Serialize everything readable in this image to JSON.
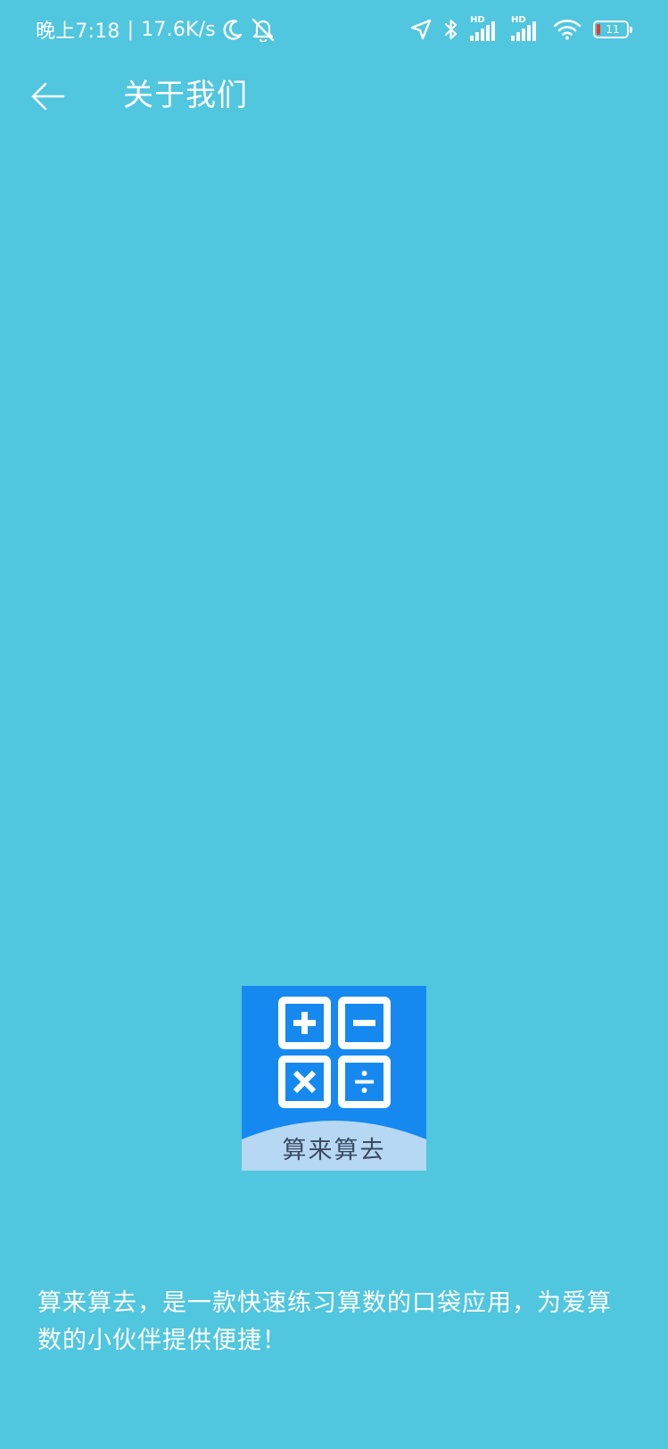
{
  "status_bar": {
    "time": "晚上7:18",
    "separator": "|",
    "net_speed": "17.6K/s",
    "sim1_label": "HD",
    "sim2_label": "HD",
    "battery_level": "11",
    "battery_color": "#e53935",
    "icons": [
      "moon-icon",
      "bell-off-icon",
      "location-arrow-icon",
      "bluetooth-icon",
      "signal-icon",
      "wifi-icon",
      "battery-icon"
    ]
  },
  "header": {
    "back_icon": "arrow-left-icon",
    "title": "关于我们"
  },
  "logo": {
    "label": "算来算去",
    "background_color": "#1589f0",
    "symbols": [
      "plus",
      "minus",
      "times",
      "divide"
    ]
  },
  "description": {
    "text": "算来算去，是一款快速练习算数的口袋应用，为爱算数的小伙伴提供便捷！"
  },
  "theme": {
    "background": "#50c6df",
    "text": "#ffffff"
  }
}
